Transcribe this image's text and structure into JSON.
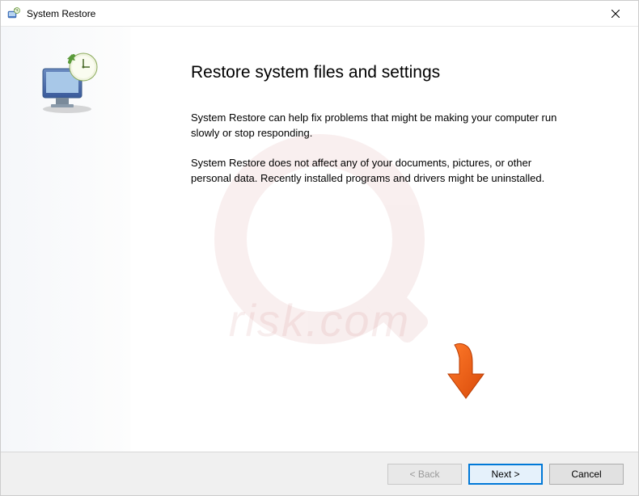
{
  "titlebar": {
    "title": "System Restore"
  },
  "content": {
    "heading": "Restore system files and settings",
    "paragraph1": "System Restore can help fix problems that might be making your computer run slowly or stop responding.",
    "paragraph2": "System Restore does not affect any of your documents, pictures, or other personal data. Recently installed programs and drivers might be uninstalled."
  },
  "buttons": {
    "back": "< Back",
    "next": "Next >",
    "cancel": "Cancel"
  },
  "watermark": {
    "text": "risk.com"
  }
}
